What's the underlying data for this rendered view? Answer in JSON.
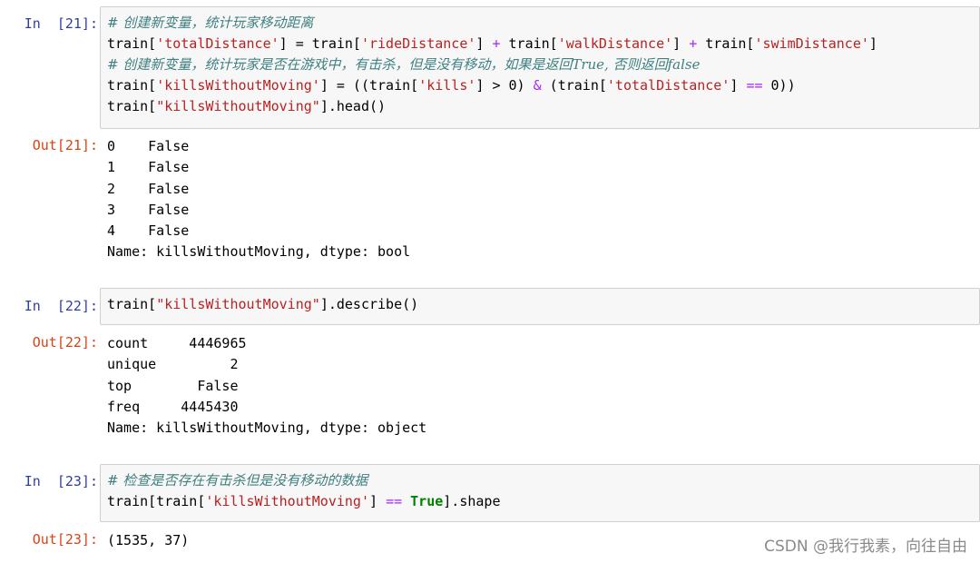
{
  "cells": [
    {
      "in_prompt": "In  [21]:",
      "code": [
        {
          "comment": "# 创建新变量，统计玩家移动距离"
        },
        {
          "pre": "train[",
          "s1": "'totalDistance'",
          "mid1": "] = train[",
          "s2": "'rideDistance'",
          "mid2": "] ",
          "op1": "+",
          "mid3": " train[",
          "s3": "'walkDistance'",
          "mid4": "] ",
          "op2": "+",
          "mid5": " train[",
          "s4": "'swimDistance'",
          "end": "]"
        },
        {
          "comment": "# 创建新变量，统计玩家是否在游戏中，有击杀，但是没有移动，如果是返回True, 否则返回false"
        },
        {
          "pre": "train[",
          "s1": "'killsWithoutMoving'",
          "mid1": "] = ((train[",
          "s2": "'kills'",
          "mid2": "] > 0) ",
          "op1": "&",
          "mid3": " (train[",
          "s3": "'totalDistance'",
          "mid4": "] ",
          "op2": "==",
          "end": " 0))"
        },
        {
          "pre": "train[",
          "s1": "\"killsWithoutMoving\"",
          "end": "].head()"
        }
      ],
      "out_prompt": "Out[21]:",
      "output": [
        "0    False",
        "1    False",
        "2    False",
        "3    False",
        "4    False",
        "Name: killsWithoutMoving, dtype: bool"
      ]
    },
    {
      "in_prompt": "In  [22]:",
      "code": [
        {
          "pre": "train[",
          "s1": "\"killsWithoutMoving\"",
          "end": "].describe()"
        }
      ],
      "out_prompt": "Out[22]:",
      "output": [
        "count     4446965",
        "unique         2",
        "top        False",
        "freq     4445430",
        "Name: killsWithoutMoving, dtype: object"
      ]
    },
    {
      "in_prompt": "In  [23]:",
      "code": [
        {
          "comment": "# 检查是否存在有击杀但是没有移动的数据"
        },
        {
          "pre": "train[train[",
          "s1": "'killsWithoutMoving'",
          "mid1": "] ",
          "op1": "==",
          "mid2": " ",
          "kw": "True",
          "end": "].shape"
        }
      ],
      "out_prompt": "Out[23]:",
      "output": [
        "(1535, 37)"
      ]
    }
  ],
  "watermark": "CSDN @我行我素，向往自由"
}
